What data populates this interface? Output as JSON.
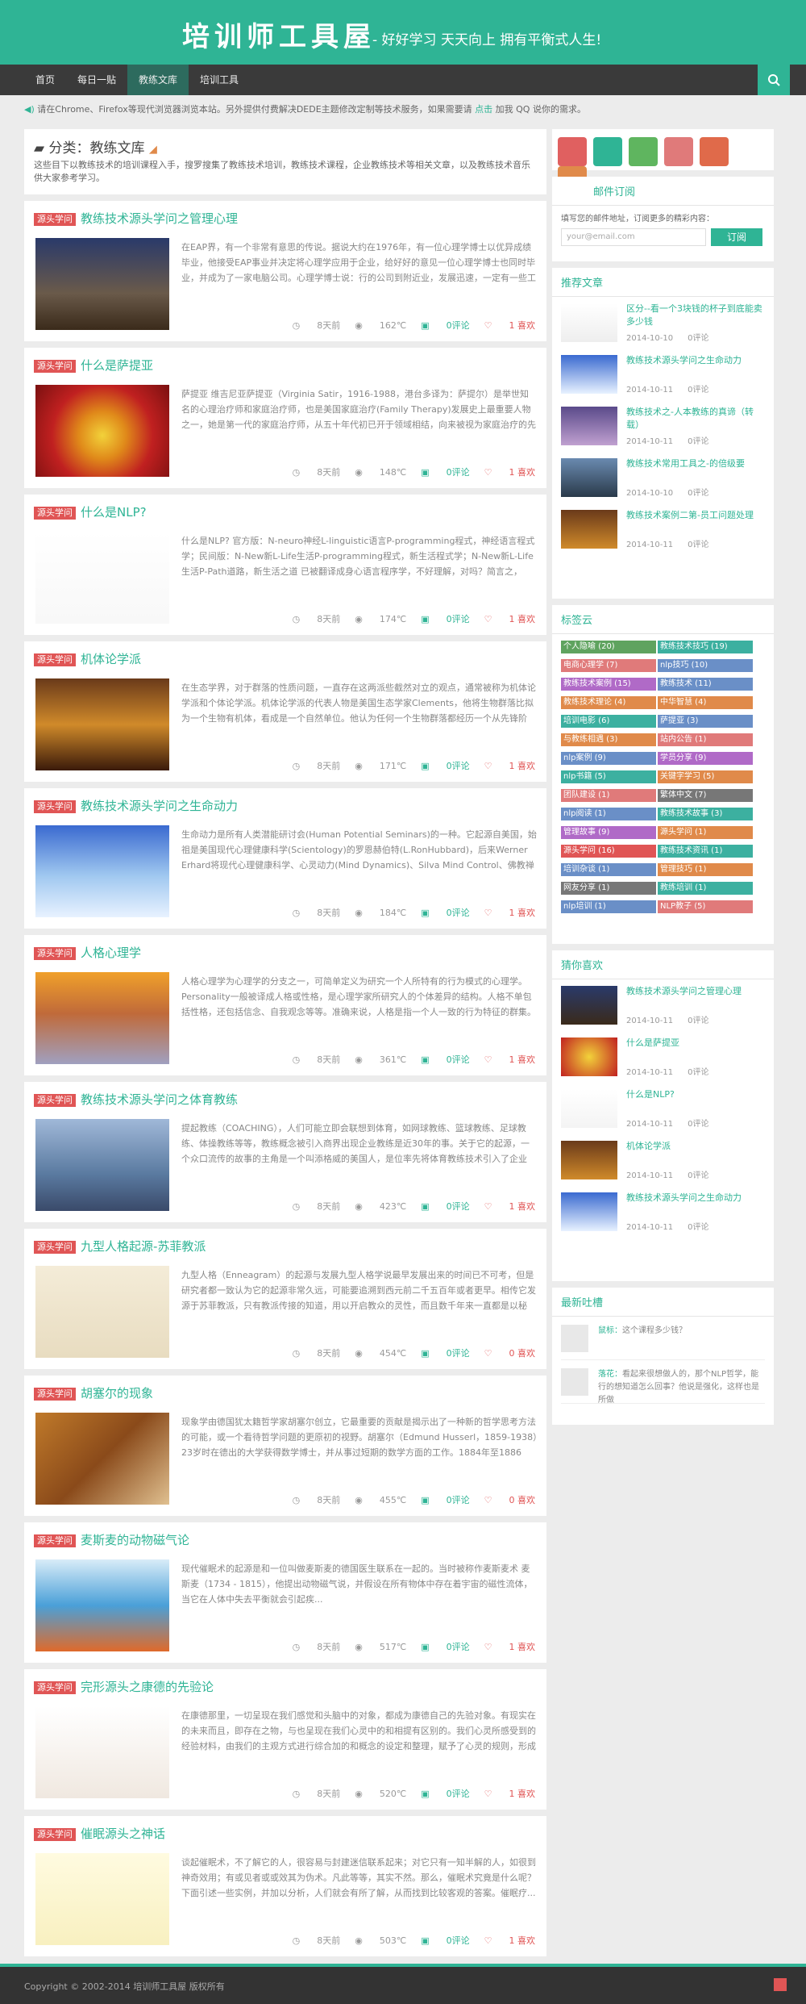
{
  "header": {
    "logo": "培训师工具屋",
    "slogan": "- 好好学习 天天向上 拥有平衡式人生!"
  },
  "nav": {
    "items": [
      "首页",
      "每日一贴",
      "教练文库",
      "培训工具"
    ],
    "active": 2
  },
  "notice": {
    "text": "请在Chrome、Firefox等现代浏览器浏览本站。另外提供付费解决DEDE主题修改定制等技术服务，如果需要请",
    "link": "点击",
    "tail": "加我 QQ 说你的需求。"
  },
  "category": {
    "prefix": "分类：",
    "name": "教练文库",
    "description": "这些目下以教练技术的培训课程入手，搜罗搜集了教练技术培训，教练技术课程，企业教练技术等相关文章，以及教练技术音乐供大家参考学习。"
  },
  "posts": [
    {
      "tag": "源头学问",
      "title": "教练技术源头学问之管理心理",
      "excerpt": "在EAP界，有一个非常有意思的传说。据说大约在1976年，有一位心理学博士以优异成绩毕业，他接受EAP事业并决定将心理学应用于企业，给好好的意见一位心理学博士也同时毕业，并成为了一家电脑公司。心理学博士说：行的公司到附近业，发展迅速，一定有一些工作压力需要有专...",
      "days": "8天前",
      "views": "162℃",
      "comments": "0评论",
      "likes": "1 喜欢"
    },
    {
      "tag": "源头学问",
      "title": "什么是萨提亚",
      "excerpt": "萨提亚 维吉尼亚萨提亚（Virginia Satir，1916-1988，港台多译为：萨提尔）是举世知名的心理治疗师和家庭治疗师，也是美国家庭治疗(Family Therapy)发展史上最重要人物之一，她是第一代的家庭治疗师，从五十年代初已开于领域相结，向来被视为家庭治疗的先驱/...",
      "days": "8天前",
      "views": "148℃",
      "comments": "0评论",
      "likes": "1 喜欢"
    },
    {
      "tag": "源头学问",
      "title": "什么是NLP?",
      "excerpt": "什么是NLP? 官方版：N-neuro神经L-linguistic语言P-programming程式，神经语言程式学；民间版：N-New新L-Life生活P-programming程式，新生活程式学；N-New新L-Life生活P-Path道路，新生活之道 已被翻译成身心语言程序学，不好理解，对吗？简言之，NLP就是从...",
      "days": "8天前",
      "views": "174℃",
      "comments": "0评论",
      "likes": "1 喜欢"
    },
    {
      "tag": "源头学问",
      "title": "机体论学派",
      "excerpt": "在生态学界，对于群落的性质问题，一直存在这两派些截然对立的观点，通常被称为机体论学派和个体论学派。机体论学派的代表人物是美国生态学家Clements，他将生物群落比拟为一个生物有机体，看成是一个自然单位。他认为任何一个生物群落都经历一个从先锋阶段...",
      "days": "8天前",
      "views": "171℃",
      "comments": "0评论",
      "likes": "1 喜欢"
    },
    {
      "tag": "源头学问",
      "title": "教练技术源头学问之生命动力",
      "excerpt": "生命动力是所有人类潜能研讨会(Human Potential Seminars)的一种。它起源自美国，始祖是美国现代心理健康科学(Scientology)的罗恩赫伯特(L.RonHubbard)，后来Werner Erhard将现代心理健康科学、心灵动力(Mind Dynamics)、Silva Mind Control、佛教禅宗思想结...",
      "days": "8天前",
      "views": "184℃",
      "comments": "0评论",
      "likes": "1 喜欢"
    },
    {
      "tag": "源头学问",
      "title": "人格心理学",
      "excerpt": "人格心理学为心理学的分支之一，可简单定义为研究一个人所特有的行为模式的心理学。Personality一般被译成人格或性格，是心理学家所研究人的个体差异的结构。人格不单包括性格，还包括信念、自我观念等等。准确来说，人格是指一个人一致的行为特征的群集。人格的组成特...",
      "days": "8天前",
      "views": "361℃",
      "comments": "0评论",
      "likes": "1 喜欢"
    },
    {
      "tag": "源头学问",
      "title": "教练技术源头学问之体育教练",
      "excerpt": "提起教练（COACHING），人们可能立即会联想到体育，如网球教练、篮球教练、足球教练、体操教练等等，教练概念被引入商界出现企业教练是近30年的事。关于它的起源，一个众口流传的故事的主角是一个叫添格威的美国人，是位率先将体育教练技术引入了企业界。197...",
      "days": "8天前",
      "views": "423℃",
      "comments": "0评论",
      "likes": "1 喜欢"
    },
    {
      "tag": "源头学问",
      "title": "九型人格起源-苏菲教派",
      "excerpt": "九型人格（Enneagram）的起源与发展九型人格学说最早发展出来的时间已不可考，但是研究者都一致认为它的起源非常久远，可能要追溯到西元前二千五百年或者更早。相传它发源于苏菲教派，只有教派传接的知道，用以开启教众的灵性，而且数千年来一直都是以秘密...",
      "days": "8天前",
      "views": "454℃",
      "comments": "0评论",
      "likes": "0 喜欢"
    },
    {
      "tag": "源头学问",
      "title": "胡塞尔的现象",
      "excerpt": "现象学由德国犹太籍哲学家胡塞尔创立，它最重要的贡献是揭示出了一种新的哲学思考方法的可能，或一个看待哲学问题的更原初的视野。胡塞尔（Edmund Husserl，1859-1938）23岁时在德出的大学获得数学博士，并从事过短期的数学方面的工作。1884年至1886年，他...",
      "days": "8天前",
      "views": "455℃",
      "comments": "0评论",
      "likes": "0 喜欢"
    },
    {
      "tag": "源头学问",
      "title": "麦斯麦的动物磁气论",
      "excerpt": "现代催眠术的起源是和一位叫做麦斯麦的德国医生联系在一起的。当时被称作麦斯麦术 麦斯麦（1734 - 1815），他提出动物磁气说，并假设在所有物体中存在着宇宙的磁性流体，当它在人体中失去平衡就会引起疾...",
      "days": "8天前",
      "views": "517℃",
      "comments": "0评论",
      "likes": "1 喜欢"
    },
    {
      "tag": "源头学问",
      "title": "完形源头之康德的先验论",
      "excerpt": "在康德那里，一切呈现在我们感觉和头脑中的对象，都成为康德自己的先验对象。有现实在的未来而且，即存在之物，与也呈现在我们心灵中的和相提有区别的。我们心灵所感受到的经验材料，由我们的主观方式进行综合加的和概念的设定和整理，赋予了心灵的规则，形成人类...",
      "days": "8天前",
      "views": "520℃",
      "comments": "0评论",
      "likes": "1 喜欢"
    },
    {
      "tag": "源头学问",
      "title": "催眠源头之神话",
      "excerpt": "谈起催眠术，不了解它的人，很容易与封建迷信联系起来；对它只有一知半解的人，如很到神奇效用；有或见者或或效其为伪术。凡此等等，其实不然。那么，催眠术究竟是什么呢？下面引述一些实例，并加以分析，人们就会有所了解，从而找到比较客观的答案。催眠疗...",
      "days": "8天前",
      "views": "503℃",
      "comments": "0评论",
      "likes": "1 喜欢"
    }
  ],
  "sidebar": {
    "mail": {
      "title": "邮件订阅",
      "text": "填写您的邮件地址，订阅更多的精彩内容：",
      "placeholder": "your@email.com",
      "button": "订阅"
    },
    "recommended": {
      "title": "推荐文章",
      "items": [
        {
          "title": "区分--看一个3块钱的杯子到底能卖多少钱",
          "date": "2014-10-10",
          "comments": "0评论"
        },
        {
          "title": "教练技术源头学问之生命动力",
          "date": "2014-10-11",
          "comments": "0评论"
        },
        {
          "title": "教练技术之-人本教练的真谛（转载）",
          "date": "2014-10-11",
          "comments": "0评论"
        },
        {
          "title": "教练技术常用工具之-的倍级要",
          "date": "2014-10-10",
          "comments": "0评论"
        },
        {
          "title": "教练技术案例二第-员工问题处理",
          "date": "2014-10-11",
          "comments": "0评论"
        }
      ]
    },
    "tagcloud": {
      "title": "标签云",
      "tags": [
        {
          "name": "个人隐喻 (20)",
          "color": "#5fa35f"
        },
        {
          "name": "教练技术技巧 (19)",
          "color": "#3cb0a0"
        },
        {
          "name": "电商心理学 (7)",
          "color": "#e07a7a"
        },
        {
          "name": "nlp技巧 (10)",
          "color": "#6a8fc7"
        },
        {
          "name": "教练技术案例 (15)",
          "color": "#b06ac7"
        },
        {
          "name": "教练技术 (11)",
          "color": "#6a8fc7"
        },
        {
          "name": "教练技术理论 (4)",
          "color": "#e08a4a"
        },
        {
          "name": "中华智慧 (4)",
          "color": "#e08a4a"
        },
        {
          "name": "培训电影 (6)",
          "color": "#3cb0a0"
        },
        {
          "name": "萨提亚 (3)",
          "color": "#6a8fc7"
        },
        {
          "name": "与教练相遇 (3)",
          "color": "#e08a4a"
        },
        {
          "name": "站内公告 (1)",
          "color": "#e07a7a"
        },
        {
          "name": "nlp案例 (9)",
          "color": "#6a8fc7"
        },
        {
          "name": "学员分享 (9)",
          "color": "#b06ac7"
        },
        {
          "name": "nlp书籍 (5)",
          "color": "#3cb0a0"
        },
        {
          "name": "关键字学习 (5)",
          "color": "#e08a4a"
        },
        {
          "name": "团队建设 (1)",
          "color": "#e07a7a"
        },
        {
          "name": "繁体中文 (7)",
          "color": "#777777"
        },
        {
          "name": "nlp阅读 (1)",
          "color": "#6a8fc7"
        },
        {
          "name": "教练技术故事 (3)",
          "color": "#3cb0a0"
        },
        {
          "name": "管理故事 (9)",
          "color": "#b06ac7"
        },
        {
          "name": "源头学问 (1)",
          "color": "#e08a4a"
        },
        {
          "name": "源头学问 (16)",
          "color": "#e05555"
        },
        {
          "name": "教练技术资讯 (1)",
          "color": "#3cb0a0"
        },
        {
          "name": "培训杂谈 (1)",
          "color": "#6a8fc7"
        },
        {
          "name": "管理技巧 (1)",
          "color": "#e08a4a"
        },
        {
          "name": "网友分享 (1)",
          "color": "#777777"
        },
        {
          "name": "教练培训 (1)",
          "color": "#3cb0a0"
        },
        {
          "name": "nlp培训 (1)",
          "color": "#6a8fc7"
        },
        {
          "name": "NLP教子 (5)",
          "color": "#e07a7a"
        }
      ]
    },
    "guess": {
      "title": "猜你喜欢",
      "items": [
        {
          "title": "教练技术源头学问之管理心理",
          "date": "2014-10-11",
          "comments": "0评论"
        },
        {
          "title": "什么是萨提亚",
          "date": "2014-10-11",
          "comments": "0评论"
        },
        {
          "title": "什么是NLP?",
          "date": "2014-10-11",
          "comments": "0评论"
        },
        {
          "title": "机体论学派",
          "date": "2014-10-11",
          "comments": "0评论"
        },
        {
          "title": "教练技术源头学问之生命动力",
          "date": "2014-10-11",
          "comments": "0评论"
        }
      ]
    },
    "comments": {
      "title": "最新吐槽",
      "items": [
        {
          "name": "鼠标：",
          "text": "这个课程多少钱？"
        },
        {
          "name": "落花：",
          "text": "看起来很想做人的，那个NLP哲学，能行的想知道怎么回事？他说是强化，这样也是所做"
        }
      ]
    }
  },
  "footer": {
    "copyright": "Copyright © 2002-2014 培训师工具屋 版权所有"
  },
  "colors": {
    "brand": "#2fb495",
    "tag_red": "#e05555",
    "nav_bg": "#3a3a3a"
  },
  "icons": [
    "weibo-icon",
    "pinterest-icon",
    "wechat-icon",
    "mail-icon",
    "qq-icon",
    "rss-icon",
    "search-icon",
    "eye-icon",
    "comment-icon",
    "heart-icon",
    "clock-icon",
    "folder-icon",
    "speaker-icon"
  ]
}
